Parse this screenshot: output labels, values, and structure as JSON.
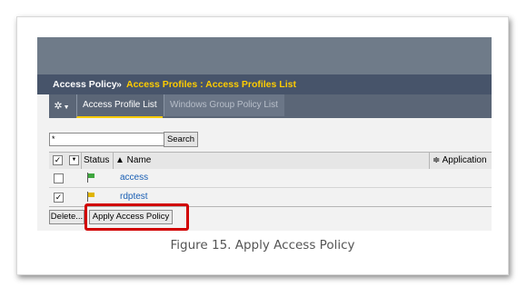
{
  "breadcrumb": {
    "root": "Access Policy",
    "separator": "»",
    "path": "Access Profiles : Access Profiles List"
  },
  "tabs": [
    {
      "label": "Access Profile List",
      "active": true
    },
    {
      "label": "Windows Group Policy List",
      "active": false
    }
  ],
  "toolbar": {
    "gear_icon": "gear-icon",
    "gear_glyph": "✲"
  },
  "search": {
    "value": "*",
    "button_label": "Search"
  },
  "table": {
    "headers": {
      "status": "Status",
      "name": "▲ Name",
      "application": "≑ Application"
    },
    "rows": [
      {
        "checked": false,
        "status_color": "#3fa63f",
        "name": "access"
      },
      {
        "checked": true,
        "status_color": "#e0b400",
        "name": "rdptest"
      }
    ]
  },
  "actions": {
    "delete_label": "Delete...",
    "apply_label": "Apply Access Policy"
  },
  "caption": "Figure 15. Apply Access Policy",
  "colors": {
    "breadcrumb_accent": "#ffcc00",
    "highlight": "#d10000",
    "link": "#1a5fb4"
  }
}
